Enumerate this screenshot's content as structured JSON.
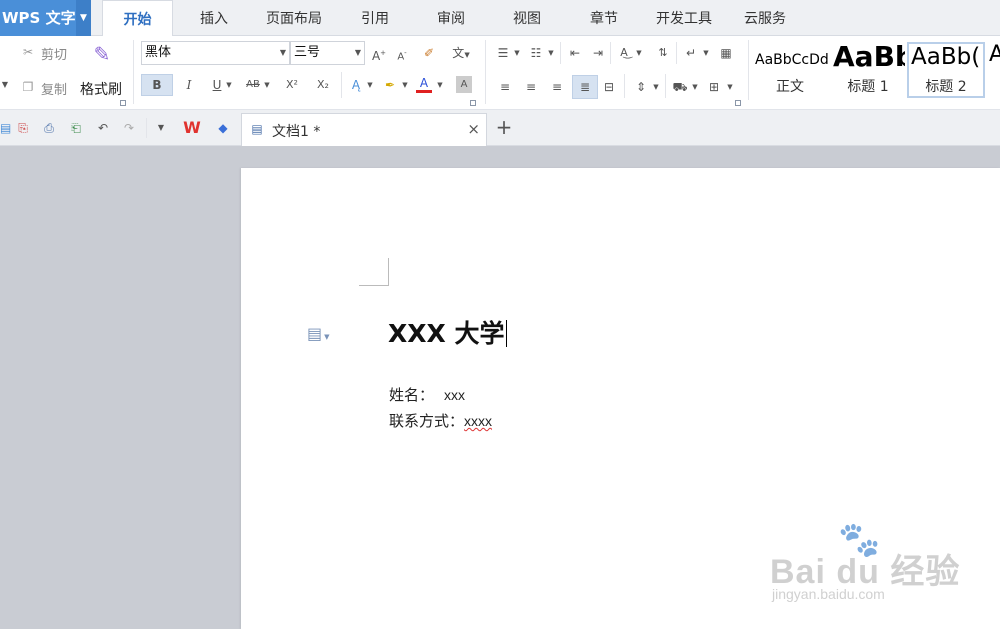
{
  "app": {
    "menu_label": "WPS 文字",
    "menu_arrow": "▼"
  },
  "tabs": [
    {
      "label": "开始",
      "active": true
    },
    {
      "label": "插入"
    },
    {
      "label": "页面布局"
    },
    {
      "label": "引用"
    },
    {
      "label": "审阅"
    },
    {
      "label": "视图"
    },
    {
      "label": "章节"
    },
    {
      "label": "开发工具"
    },
    {
      "label": "云服务"
    }
  ],
  "clipboard": {
    "cut": "剪切",
    "copy": "复制",
    "format_painter": "格式刷"
  },
  "font": {
    "family": "黑体",
    "size": "三号",
    "dropdown_arrow": "▼"
  },
  "format_buttons": {
    "bold": "B",
    "italic": "I",
    "underline": "U",
    "strike": "AB",
    "superscript": "X²",
    "subscript": "X₂",
    "font_color": "A",
    "char_shade": "A"
  },
  "styles": [
    {
      "sample": "AaBbCcDd",
      "name": "正文"
    },
    {
      "sample": "AaBb",
      "name": "标题 1"
    },
    {
      "sample": "AaBb(",
      "name": "标题 2",
      "selected": true
    },
    {
      "sample": "A",
      "name": ""
    }
  ],
  "doc_tab": {
    "title": "文档1 *",
    "close": "×",
    "new_tab": "+"
  },
  "document": {
    "title": "XXX 大学",
    "name_label": "姓名：",
    "name_value": "xxx",
    "contact_label": "联系方式：",
    "contact_value": "xxxx"
  },
  "watermark": {
    "main": "Bai du 经验",
    "sub": "jingyan.baidu.com"
  },
  "colors": {
    "accent": "#4a8fd8",
    "active_tab_text": "#2f6fc1",
    "canvas": "#c9ccd3"
  }
}
